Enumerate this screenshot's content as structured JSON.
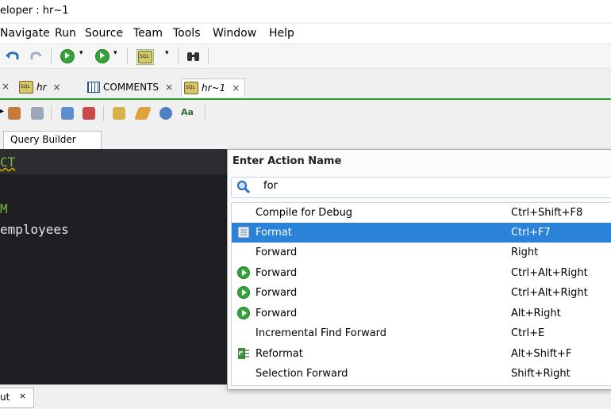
{
  "window": {
    "title": "eloper : hr~1"
  },
  "menu": {
    "items": [
      "Navigate",
      "Run",
      "Source",
      "Team",
      "Tools",
      "Window",
      "Help"
    ]
  },
  "toolbar": {
    "icons": [
      "undo-icon",
      "redo-icon",
      "back-icon",
      "forward-icon",
      "sql-worksheet-icon",
      "binoculars-icon"
    ]
  },
  "tabs": [
    {
      "label": "hr",
      "icon": "sql-icon"
    },
    {
      "label": "COMMENTS",
      "icon": "table-icon"
    },
    {
      "label": "hr~1",
      "icon": "sql-icon",
      "active": true
    }
  ],
  "editor_tabs": {
    "query_builder": "Query Builder"
  },
  "editor": {
    "lines": [
      "CT",
      "M",
      "employees"
    ]
  },
  "bottom": {
    "output_tab": "ut",
    "output_close": "×"
  },
  "popup": {
    "title": "Enter Action Name",
    "search_value": "for",
    "items": [
      {
        "name": "Compile for Debug",
        "shortcut": "Ctrl+Shift+F8",
        "icon": ""
      },
      {
        "name": "Format",
        "shortcut": "Ctrl+F7",
        "icon": "format-icon",
        "selected": true
      },
      {
        "name": "Forward",
        "shortcut": "Right",
        "icon": ""
      },
      {
        "name": "Forward",
        "shortcut": "Ctrl+Alt+Right",
        "icon": "green-forward-icon"
      },
      {
        "name": "Forward",
        "shortcut": "Ctrl+Alt+Right",
        "icon": "green-forward-icon"
      },
      {
        "name": "Forward",
        "shortcut": "Alt+Right",
        "icon": "green-forward-icon"
      },
      {
        "name": "Incremental Find Forward",
        "shortcut": "Ctrl+E",
        "icon": ""
      },
      {
        "name": "Reformat",
        "shortcut": "Alt+Shift+F",
        "icon": "reformat-icon"
      },
      {
        "name": "Selection Forward",
        "shortcut": "Shift+Right",
        "icon": ""
      }
    ]
  },
  "colors": {
    "selection": "#2a83d8",
    "editor_bg": "#1e1f22",
    "keyword": "#7fb347",
    "accent_tab": "#2d9b2d"
  }
}
